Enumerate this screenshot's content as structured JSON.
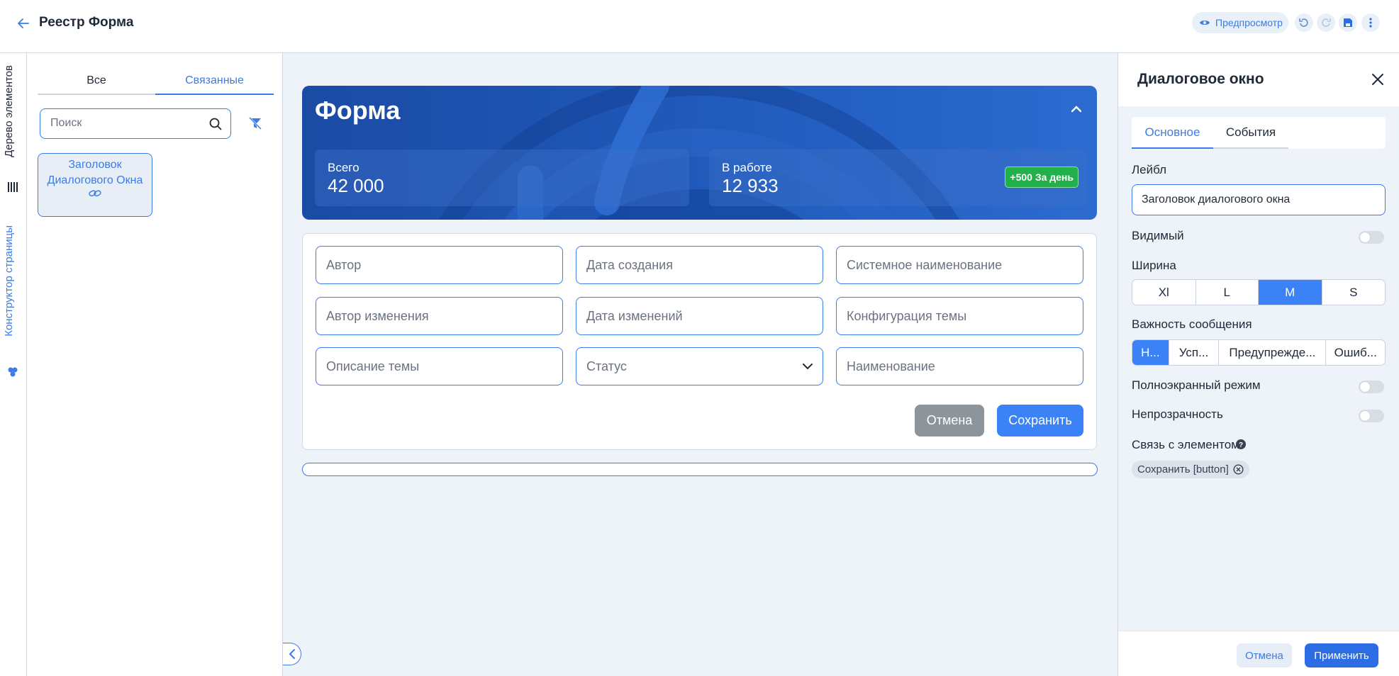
{
  "header": {
    "title": "Реестр Форма",
    "preview_label": "Предпросмотр"
  },
  "side_tabs": {
    "tree": "Дерево элементов",
    "constructor": "Конструктор страницы"
  },
  "left_panel": {
    "tabs": [
      "Все",
      "Связанные"
    ],
    "active_tab": "Связанные",
    "search_placeholder": "Поиск",
    "tree_item": "Заголовок Диалогового Окна"
  },
  "banner": {
    "title": "Форма",
    "stats": [
      {
        "label": "Всего",
        "value": "42 000"
      },
      {
        "label": "В работе",
        "value": "12 933",
        "badge": "+500 За день"
      }
    ]
  },
  "form": {
    "fields": [
      "Автор",
      "Дата создания",
      "Системное наименование",
      "Автор изменения",
      "Дата изменений",
      "Конфигурация темы",
      "Описание темы",
      "Статус",
      "Наименование"
    ],
    "cancel_label": "Отмена",
    "save_label": "Сохранить"
  },
  "right_panel": {
    "title": "Диалоговое окно",
    "tabs": [
      "Основное",
      "События"
    ],
    "active_tab": "Основное",
    "label_title": "Лейбл",
    "label_value": "Заголовок диалогового окна",
    "visible_label": "Видимый",
    "width_label": "Ширина",
    "width_options": [
      "Xl",
      "L",
      "M",
      "S"
    ],
    "width_selected": "M",
    "importance_label": "Важность сообщения",
    "importance_options": [
      "Н...",
      "Усп...",
      "Предупрежде...",
      "Ошиб..."
    ],
    "importance_selected": "Н...",
    "fullscreen_label": "Полноэкранный режим",
    "opacity_label": "Непрозрачность",
    "link_label": "Связь с элементом",
    "link_chip": "Сохранить [button]",
    "cancel_label": "Отмена",
    "apply_label": "Применить"
  },
  "colors": {
    "accent": "#3b82f6",
    "banner": "#1e56b5",
    "success": "#22b04b",
    "canvas_bg": "#eef2f9"
  }
}
